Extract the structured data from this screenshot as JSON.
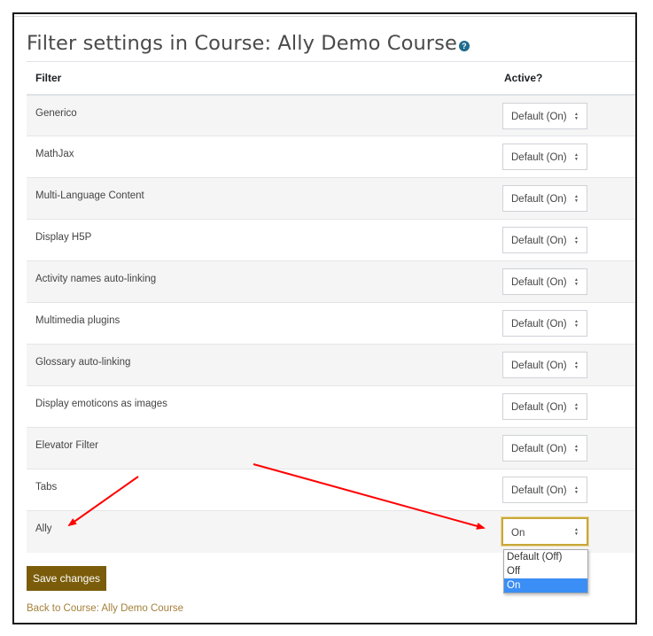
{
  "page": {
    "title": "Filter settings in Course: Ally Demo Course",
    "help_icon": "question-circle-icon"
  },
  "table": {
    "headers": {
      "filter": "Filter",
      "active": "Active?"
    },
    "rows": [
      {
        "name": "Generico",
        "value": "Default (On)"
      },
      {
        "name": "MathJax",
        "value": "Default (On)"
      },
      {
        "name": "Multi-Language Content",
        "value": "Default (On)"
      },
      {
        "name": "Display H5P",
        "value": "Default (On)"
      },
      {
        "name": "Activity names auto-linking",
        "value": "Default (On)"
      },
      {
        "name": "Multimedia plugins",
        "value": "Default (On)"
      },
      {
        "name": "Glossary auto-linking",
        "value": "Default (On)"
      },
      {
        "name": "Display emoticons as images",
        "value": "Default (On)"
      },
      {
        "name": "Elevator Filter",
        "value": "Default (On)"
      },
      {
        "name": "Tabs",
        "value": "Default (On)"
      },
      {
        "name": "Ally",
        "value": "On"
      }
    ]
  },
  "ally_dropdown": {
    "selected": "On",
    "options": [
      "Default (Off)",
      "Off",
      "On"
    ],
    "highlighted_index": 2
  },
  "actions": {
    "save_label": "Save changes",
    "back_link": "Back to Course: Ally Demo Course"
  },
  "colors": {
    "primary_button": "#7a5c0a",
    "link": "#a5803a",
    "focus_border": "#c9a73a",
    "dropdown_highlight": "#3b8ef5",
    "annotation_arrow": "#ff0000"
  }
}
